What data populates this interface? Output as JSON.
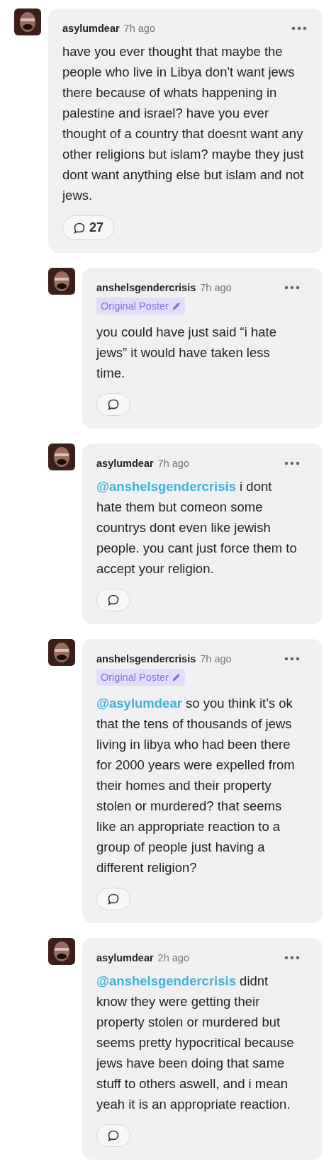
{
  "comment": {
    "author": "asylumdear",
    "time": "7h ago",
    "text": "have you ever thought that maybe the people who live in Libya don't want jews there because of whats happening in palestine and israel? have you ever thought of a country that doesnt want any other religions but islam? maybe they just dont want anything else but islam and not jews.",
    "reply_count": "27",
    "replies": [
      {
        "author": "anshelsgendercrisis",
        "time": "7h ago",
        "badge": "Original Poster",
        "text": "you could have just said “i hate jews” it would have taken less time."
      },
      {
        "author": "asylumdear",
        "time": "7h ago",
        "mention": "@anshelsgendercrisis",
        "text": "i dont hate them but comeon some countrys dont even like jewish people. you cant just force them to accept your religion."
      },
      {
        "author": "anshelsgendercrisis",
        "time": "7h ago",
        "badge": "Original Poster",
        "mention": "@asylumdear",
        "text": "so you think it’s ok that the tens of thousands of jews living in libya who had been there for 2000 years were expelled from their homes and their property stolen or murdered? that seems like an appropriate reaction to a group of people just having a different religion?"
      },
      {
        "author": "asylumdear",
        "time": "2h ago",
        "mention": "@anshelsgendercrisis",
        "text": "didnt know they were getting their property stolen or murdered but seems pretty hypocritical because jews have been doing that same stuff to others aswell, and i mean yeah it is an appropriate reaction."
      }
    ]
  }
}
